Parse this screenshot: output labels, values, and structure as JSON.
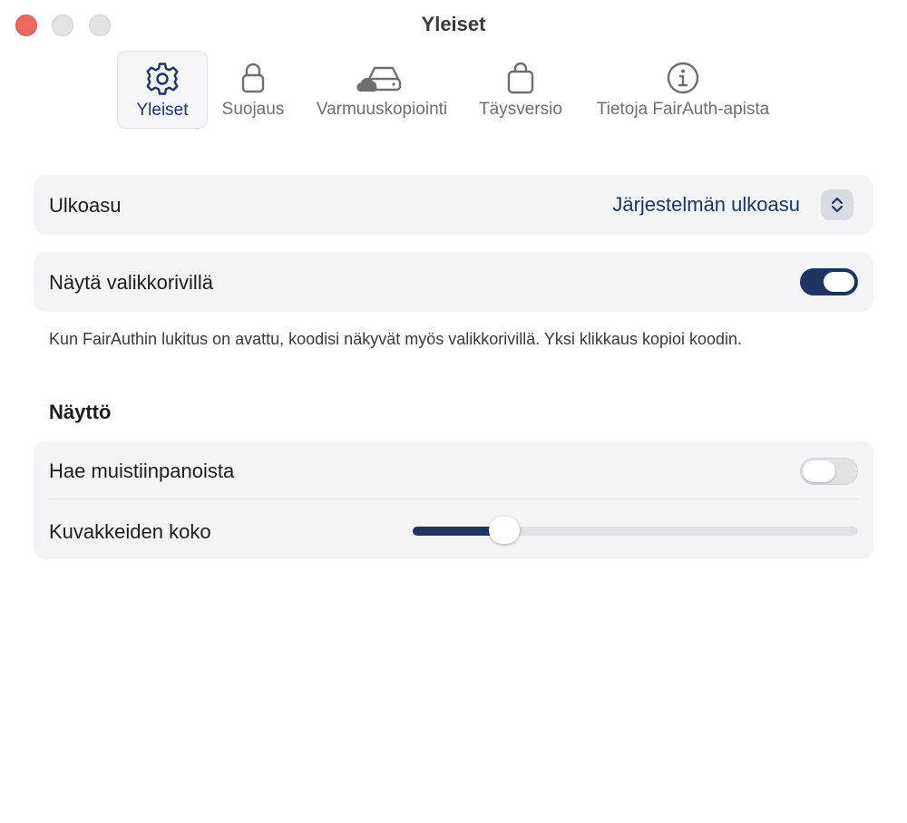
{
  "window": {
    "title": "Yleiset"
  },
  "toolbar": {
    "tabs": [
      {
        "label": "Yleiset",
        "icon": "gear-icon",
        "active": true
      },
      {
        "label": "Suojaus",
        "icon": "lock-icon",
        "active": false
      },
      {
        "label": "Varmuuskopiointi",
        "icon": "cloud-drive-icon",
        "active": false
      },
      {
        "label": "Täysversio",
        "icon": "shopping-bag-icon",
        "active": false
      },
      {
        "label": "Tietoja FairAuth-apista",
        "icon": "info-icon",
        "active": false
      }
    ]
  },
  "appearance": {
    "label": "Ulkoasu",
    "value": "Järjestelmän ulkoasu"
  },
  "menubar": {
    "label": "Näytä valikkorivillä",
    "enabled": true,
    "help": "Kun FairAuthin lukitus on avattu, koodisi näkyvät myös valikkorivillä. Yksi klikkaus kopioi koodin."
  },
  "display": {
    "title": "Näyttö",
    "search_notes": {
      "label": "Hae muistiinpanoista",
      "enabled": false
    },
    "icon_size": {
      "label": "Kuvakkeiden koko",
      "fraction": 0.19
    }
  },
  "colors": {
    "accent": "#1f3561",
    "close": "#ee6a5f",
    "card": "#f4f4f6"
  }
}
